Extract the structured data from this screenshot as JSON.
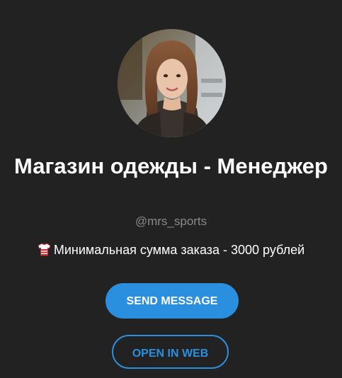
{
  "profile": {
    "title": "Магазин одежды - Менеджер",
    "username": "@mrs_sports",
    "description_icon": "shirt-icon",
    "description": "Минимальная сумма заказа - 3000 рублей"
  },
  "actions": {
    "send_message_label": "SEND MESSAGE",
    "open_in_web_label": "OPEN IN WEB"
  },
  "colors": {
    "background": "#222222",
    "accent": "#2b8fe0",
    "muted_text": "#8a8a8a"
  }
}
